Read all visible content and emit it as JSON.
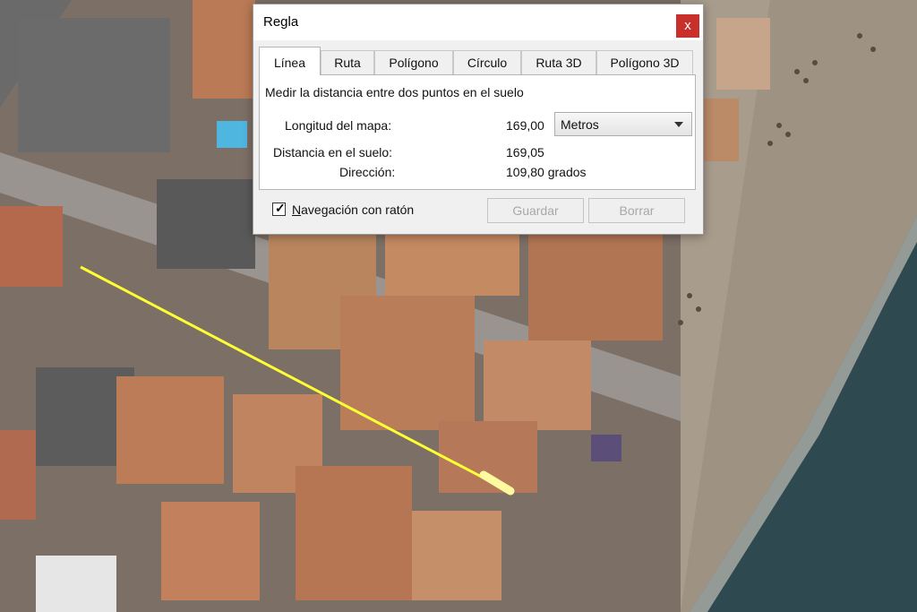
{
  "dialog": {
    "title": "Regla",
    "close_glyph": "x",
    "tabs": [
      {
        "label": "Línea",
        "active": true
      },
      {
        "label": "Ruta"
      },
      {
        "label": "Polígono"
      },
      {
        "label": "Círculo"
      },
      {
        "label": "Ruta 3D"
      },
      {
        "label": "Polígono 3D"
      }
    ],
    "description": "Medir la distancia entre dos puntos en el suelo",
    "map_length": {
      "label": "Longitud del mapa:",
      "value": "169,00"
    },
    "unit": {
      "selected": "Metros"
    },
    "ground_distance": {
      "label": "Distancia en el suelo:",
      "value": "169,05"
    },
    "heading": {
      "label": "Dirección:",
      "value": "109,80 grados"
    },
    "mouse_nav": {
      "checked": true,
      "check_glyph": "✓",
      "label_first": "N",
      "label_rest": "avegación con ratón"
    },
    "buttons": {
      "save": "Guardar",
      "clear": "Borrar"
    }
  },
  "map": {
    "ruler_color": "#ffff33",
    "sea_color": "#2e4a50",
    "sand_color": "#a89c8c"
  }
}
